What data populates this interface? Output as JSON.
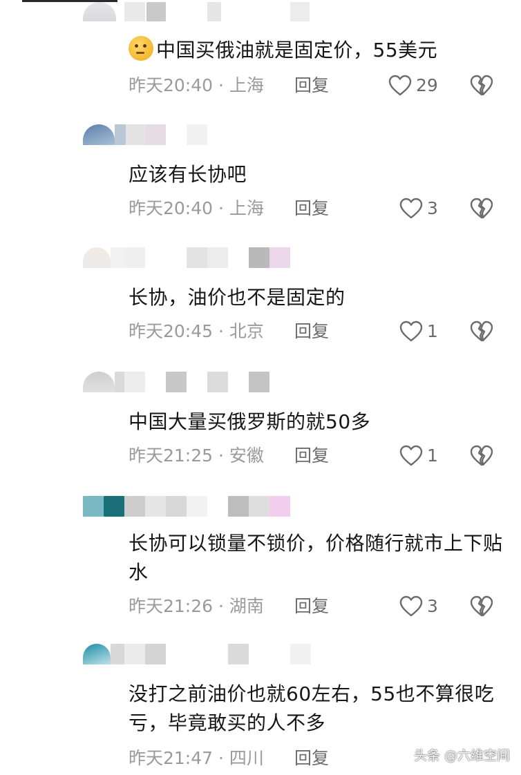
{
  "comments": [
    {
      "text": "中国买俄油就是固定价，55美元",
      "time": "昨天20:40 · 上海",
      "reply": "回复",
      "likes": "29",
      "has_emoji": true
    },
    {
      "text": "应该有长协吧",
      "time": "昨天20:40 · 上海",
      "reply": "回复",
      "likes": "3"
    },
    {
      "text": "长协，油价也不是固定的",
      "time": "昨天20:45 · 北京",
      "reply": "回复",
      "likes": "1"
    },
    {
      "text": "中国大量买俄罗斯的就50多",
      "time": "昨天21:25 · 安徽",
      "reply": "回复",
      "likes": "1"
    },
    {
      "text": "长协可以锁量不锁价，价格随行就市上下贴水",
      "time": "昨天21:26 · 湖南",
      "reply": "回复",
      "likes": "3"
    },
    {
      "text": "没打之前油价也就60左右，55也不算很吃亏，毕竟敢买的人不多",
      "time": "昨天21:47 · 四川",
      "reply": "回复",
      "likes": ""
    }
  ],
  "watermark": "头条 @六维空间",
  "icons": {
    "emoji": "thinking-face-emoji-icon",
    "like": "heart-outline-icon",
    "dislike": "broken-heart-icon"
  },
  "colors": {
    "text": "#161616",
    "meta": "#9a9a9a",
    "action": "#6b6b6b"
  }
}
